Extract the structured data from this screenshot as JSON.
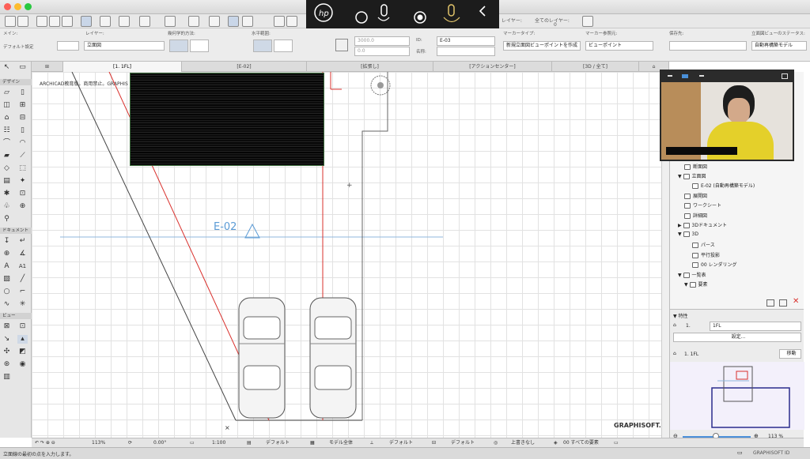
{
  "toolbar_top": {
    "layer_label": "レイヤー:",
    "all_layers_label": "全てのレイヤー:",
    "counter": "0"
  },
  "infobox": {
    "main_label": "メイン:",
    "layer_label": "レイヤー:",
    "geometry_label": "幾何学的方法:",
    "range_label": "水平範囲:",
    "marker_type_label": "マーカータイプ:",
    "marker_ref_label": "マーカー参照元:",
    "save_label": "保存先:",
    "elevation_status_label": "立面図ビューのステータス:",
    "default_settings": "デフォルト設定",
    "layer_value": "立面図",
    "length_value": "3000.0",
    "zero_value": "0.0",
    "id_label": "ID:",
    "id_value": "E-03",
    "name_label": "名称:",
    "marker_type_value": "新規立面図ビューポイントを作成",
    "marker_ref_value": "ビューポイント",
    "status_value": "自動再構築モデル"
  },
  "tabs": [
    {
      "label": "[1. 1FL]",
      "active": true
    },
    {
      "label": "[E-02]",
      "active": false
    },
    {
      "label": "[拡張し]",
      "active": false
    },
    {
      "label": "[アクションセンター]",
      "active": false
    },
    {
      "label": "[3D / 全て]",
      "active": false
    }
  ],
  "left_panel": {
    "design_header": "デザイン",
    "document_header": "ドキュメント",
    "view_header": "ビュー",
    "text_tool_label": "A",
    "label_tool_label": "A1"
  },
  "canvas": {
    "header_text": "ARCHICAD教育版。商用禁止。GRAPHIS",
    "marker_label": "E-02",
    "brand": "GRAPHISOFT."
  },
  "navigator": {
    "items": [
      {
        "label": "断面図",
        "indent": 2,
        "arrow": ""
      },
      {
        "label": "立面図",
        "indent": 1,
        "arrow": "▼"
      },
      {
        "label": "E-02 (自動再構築モデル)",
        "indent": 3,
        "arrow": ""
      },
      {
        "label": "展開図",
        "indent": 2,
        "arrow": ""
      },
      {
        "label": "ワークシート",
        "indent": 2,
        "arrow": ""
      },
      {
        "label": "詳細図",
        "indent": 2,
        "arrow": ""
      },
      {
        "label": "3Dドキュメント",
        "indent": 1,
        "arrow": "▶"
      },
      {
        "label": "3D",
        "indent": 1,
        "arrow": "▼"
      },
      {
        "label": "パース",
        "indent": 3,
        "arrow": ""
      },
      {
        "label": "平行投影",
        "indent": 3,
        "arrow": ""
      },
      {
        "label": "00 レンダリング",
        "indent": 3,
        "arrow": ""
      },
      {
        "label": "一覧表",
        "indent": 1,
        "arrow": "▼"
      },
      {
        "label": "要素",
        "indent": 2,
        "arrow": "▼"
      }
    ]
  },
  "properties": {
    "header": "特性",
    "floor_index": "1.",
    "floor_name": "1FL",
    "settings_button": "設定...",
    "view_label": "1. 1FL",
    "move_button": "移動",
    "zoom_value": "113 %"
  },
  "statusbar": {
    "zoom": "113%",
    "angle": "0.00°",
    "scale": "1:100",
    "default1": "デフォルト",
    "model_all": "モデル全体",
    "default2": "デフォルト",
    "default3": "デフォルト",
    "override": "上書きなし",
    "all_elements": "00 すべての要素"
  },
  "bottom": {
    "prompt": "立面線の最初の点を入力します。",
    "brand": "GRAPHISOFT ID"
  },
  "colors": {
    "accent_blue": "#4a90d9",
    "marker_blue": "#5b9bd5",
    "red_line": "#d9302c",
    "hp_bar": "#1c1c1c"
  }
}
